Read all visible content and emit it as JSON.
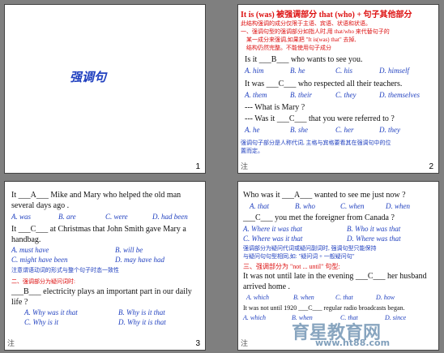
{
  "s1": {
    "title": "强调句",
    "num": "1"
  },
  "s2": {
    "heading": "It is (was) 被强调部分 that (who) + 句子其他部分",
    "sub1": "此结构强调的成分仅限于主语、宾语、状语和状语。",
    "sub2": "一、强调句型的强调部分如指人时,用 that/who 来代替句子的",
    "sub3": "某一成分来强调,如果把 \"It is(was) that\" 去掉,",
    "sub4": "结构仍然完整。不能使用句子成分",
    "q1": "Is it ___B___ who wants to see you.",
    "o1": [
      "A. him",
      "B. he",
      "C. his",
      "D. himself"
    ],
    "q2": "It was ___C___ who respected all their teachers.",
    "o2": [
      "A. them",
      "B. their",
      "C. they",
      "D. themselves"
    ],
    "q3a": "--- What is Mary ?",
    "q3b": "--- Was it ___C___ that you were referred to ?",
    "o3": [
      "A. he",
      "B. she",
      "C. her",
      "D. they"
    ],
    "note1": "强调句子部分是人称代词, 主格与宾格要看其在强调句中的位",
    "note2": "置而定。",
    "num": "2",
    "corner": "注"
  },
  "s3": {
    "q1": "It ___A___ Mike and Mary who helped the old man",
    "q1b": "several days ago .",
    "o1": [
      "A. was",
      "B. are",
      "C. were",
      "D. had been"
    ],
    "q2": "It ___C___ at Christmas that John Smith gave Mary a",
    "q2b": "handbag.",
    "o2a": [
      "A. must have",
      "B. will be"
    ],
    "o2b": [
      "C. might have been",
      "D. may have had"
    ],
    "note1": "注意谓语动词的形式与整个句子时态一致性",
    "note2": "二、强调部分为疑问词时:",
    "q3": "___B___ electricity plays an important part in our daily",
    "q3b": "life ?",
    "o3a": [
      "A. Why was it that",
      "B. Why is it that"
    ],
    "o3b": [
      "C. Why is it",
      "D. Why it is that"
    ],
    "num": "3",
    "corner": "注"
  },
  "s4": {
    "q1": "Who was it ___A___ wanted to see me just now ?",
    "o1": [
      "A. that",
      "B. who",
      "C. when",
      "D. when"
    ],
    "q2": "___C___ you met the foreigner from Canada ?",
    "o2a": [
      "A. Where it was that",
      "B. Who it was that"
    ],
    "o2b": [
      "C. Where was it that",
      "D. Where was that"
    ],
    "note1": "强调部分为疑问代词或疑问副词时, 强调句型只能保持",
    "note2": "与疑问句句型相同,如: \"疑问词 + 一般疑问句\"",
    "note3": "三、强调部分为 \"not ... until\" 句型:",
    "q3": "It was not until late in the evening ___C___ her husband",
    "q3b": "arrived home .",
    "o3": [
      "A. which",
      "B. when",
      "C. that",
      "D. how"
    ],
    "q4": "It was not until 1920 ___C___ regular radio broadcasts began.",
    "o4": [
      "A. which",
      "B. when",
      "C. that",
      "D. since"
    ],
    "corner": "注",
    "watermark": "育星教育网",
    "watermark2": "www.ht88.com"
  }
}
